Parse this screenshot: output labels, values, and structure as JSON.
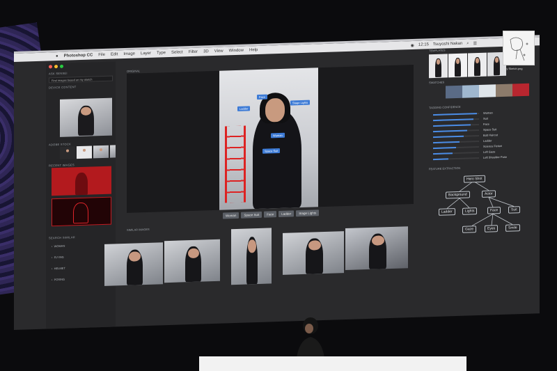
{
  "menubar": {
    "app_name": "Photoshop CC",
    "menus": [
      "File",
      "Edit",
      "Image",
      "Layer",
      "Type",
      "Select",
      "Filter",
      "3D",
      "View",
      "Window",
      "Help"
    ],
    "clock": "12:15",
    "user": "Tsuyoshi Nakan"
  },
  "left": {
    "title": "ASK SENSEI",
    "search_text": "Find images based on my sketch",
    "device_content_label": "DEVICE CONTENT",
    "adobe_stock_label": "ADOBE STOCK",
    "recent_images_label": "RECENT IMAGES",
    "search_similar_label": "SEARCH SIMILAR",
    "similar_items": [
      "WOMAN",
      "FLYING",
      "HELMET",
      "POSING"
    ]
  },
  "center": {
    "original_label": "ORIGINAL",
    "photo_tags": [
      "Face",
      "Ladder",
      "Stage Lights",
      "Woman",
      "Space Suit"
    ],
    "tag_chips": [
      "Woman",
      "Space Suit",
      "Face",
      "Ladder",
      "Stage Lights"
    ],
    "similar_label": "SIMILAR IMAGES"
  },
  "right": {
    "templates_label": "TEMPLATES",
    "swatches_label": "SWATCHES",
    "swatch_colors": [
      "#5a6b86",
      "#9fb7cf",
      "#dfe5ea",
      "#8c7b6b",
      "#b8262f"
    ],
    "tagging_label": "TAGGING CONFIDENCE",
    "confidence": [
      {
        "name": "Woman",
        "value": 0.95
      },
      {
        "name": "Suit",
        "value": 0.88
      },
      {
        "name": "Face",
        "value": 0.82
      },
      {
        "name": "Space Suit",
        "value": 0.74
      },
      {
        "name": "Bob Haircut",
        "value": 0.66
      },
      {
        "name": "Ladder",
        "value": 0.58
      },
      {
        "name": "Science Fiction",
        "value": 0.5
      },
      {
        "name": "Left Gaze",
        "value": 0.42
      },
      {
        "name": "Left Shoulder Pose",
        "value": 0.34
      }
    ],
    "feature_label": "FEATURE EXTRACTION",
    "tree": {
      "root": "Hero Shot",
      "level1": [
        "Background",
        "Actor"
      ],
      "level2": [
        "Ladder",
        "Lights",
        "Face",
        "Suit"
      ],
      "level3": [
        "Gaze",
        "Eyes",
        "Smile"
      ]
    }
  },
  "sketch": {
    "filename": "My Sketch.png"
  }
}
